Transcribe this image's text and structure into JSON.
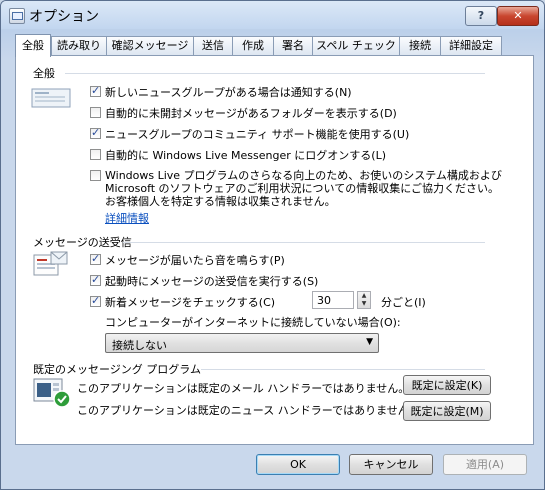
{
  "window": {
    "title": "オプション",
    "help_label": "?",
    "close_label": "✕"
  },
  "tabs": [
    {
      "label": "全般",
      "active": true
    },
    {
      "label": "読み取り"
    },
    {
      "label": "確認メッセージ"
    },
    {
      "label": "送信"
    },
    {
      "label": "作成"
    },
    {
      "label": "署名"
    },
    {
      "label": "スペル チェック"
    },
    {
      "label": "接続"
    },
    {
      "label": "詳細設定"
    }
  ],
  "general": {
    "heading": "全般",
    "options": [
      {
        "label": "新しいニュースグループがある場合は通知する(N)",
        "checked": true
      },
      {
        "label": "自動的に未開封メッセージがあるフォルダーを表示する(D)",
        "checked": false
      },
      {
        "label": "ニュースグループのコミュニティ サポート機能を使用する(U)",
        "checked": true
      },
      {
        "label": "自動的に Windows Live Messenger にログオンする(L)",
        "checked": false
      }
    ],
    "improvement": {
      "checked": false,
      "line1": "Windows Live プログラムのさらなる向上のため、お使いのシステム構成および",
      "line2": "Microsoft のソフトウェアのご利用状況についての情報収集にご協力ください。",
      "line3": "お客様個人を特定する情報は収集されません。",
      "link": "詳細情報"
    }
  },
  "send_receive": {
    "heading": "メッセージの送受信",
    "options": [
      {
        "label": "メッセージが届いたら音を鳴らす(P)",
        "checked": true
      },
      {
        "label": "起動時にメッセージの送受信を実行する(S)",
        "checked": true
      },
      {
        "label": "新着メッセージをチェックする(C)",
        "checked": true
      }
    ],
    "interval_value": "30",
    "interval_unit": "分ごと(I)",
    "offline_label": "コンピューターがインターネットに接続していない場合(O):",
    "offline_selected": "接続しない"
  },
  "default_programs": {
    "heading": "既定のメッセージング プログラム",
    "mail_text": "このアプリケーションは既定のメール ハンドラーではありません。",
    "news_text": "このアプリケーションは既定のニュース ハンドラーではありません。",
    "mail_button": "既定に設定(K)",
    "news_button": "既定に設定(M)"
  },
  "footer": {
    "ok": "OK",
    "cancel": "キャンセル",
    "apply": "適用(A)"
  }
}
